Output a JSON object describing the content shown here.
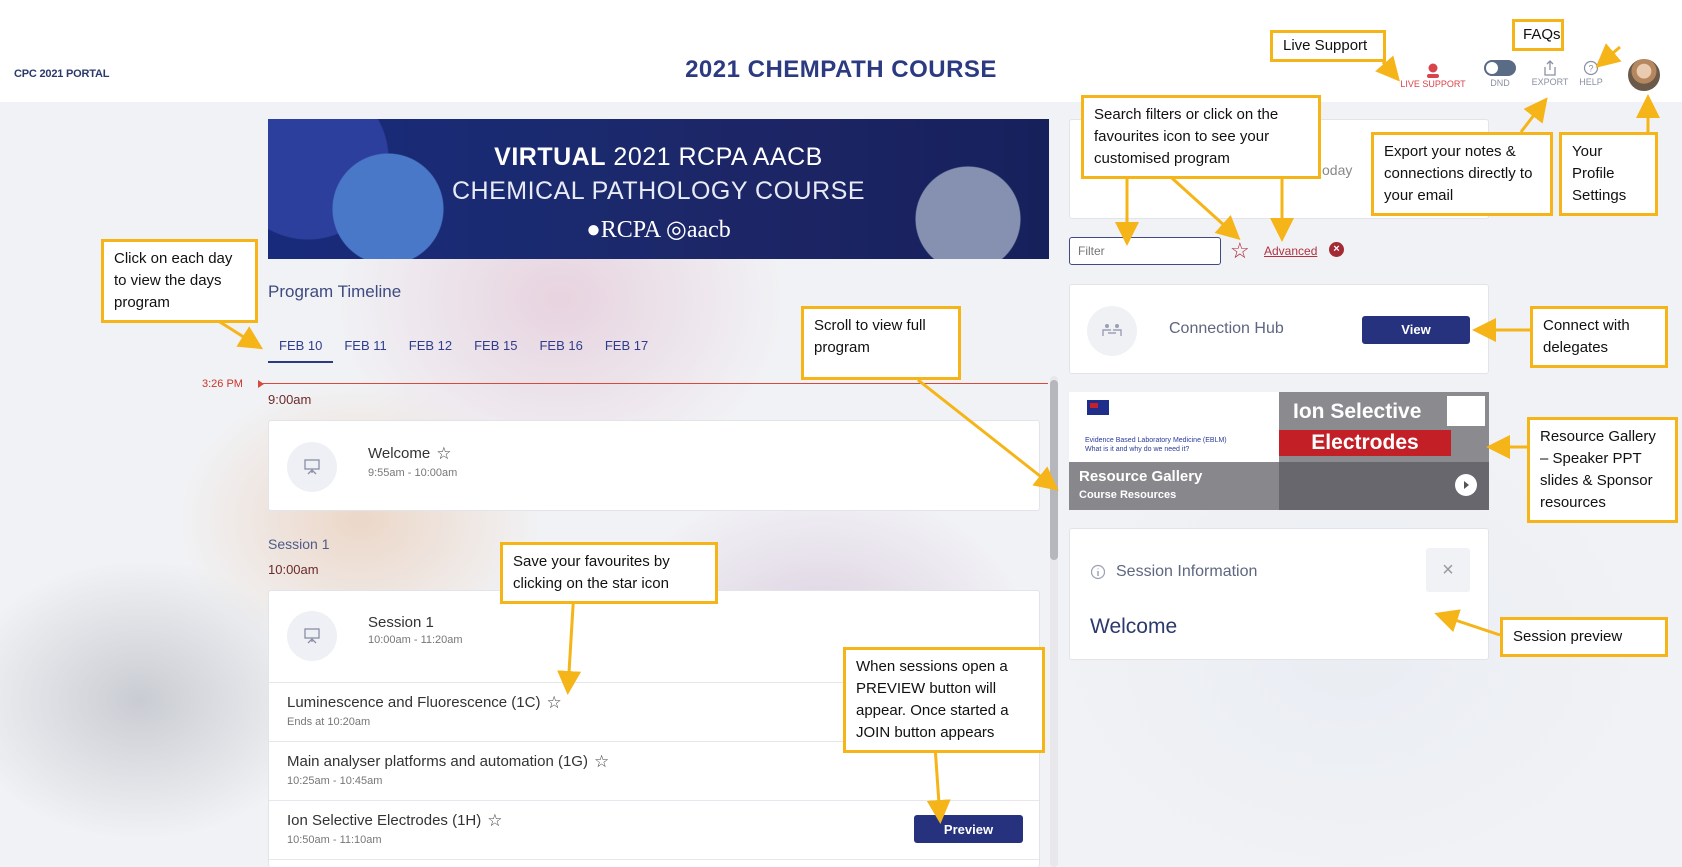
{
  "header": {
    "portal": "CPC 2021 PORTAL",
    "title": "2021 CHEMPATH COURSE",
    "live_support": "LIVE SUPPORT",
    "dnd": "DND",
    "export": "EXPORT",
    "help": "HELP"
  },
  "banner": {
    "line1_bold": "VIRTUAL",
    "line1_rest": " 2021 RCPA AACB",
    "line2": "CHEMICAL PATHOLOGY COURSE",
    "line3": "●RCPA  ◎aacb"
  },
  "timeline": {
    "title": "Program Timeline",
    "tabs": [
      "FEB 10",
      "FEB 11",
      "FEB 12",
      "FEB 15",
      "FEB 16",
      "FEB 17"
    ],
    "active_tab": "FEB 10",
    "current_time": "3:26 PM"
  },
  "schedule": {
    "slot1_time": "9:00am",
    "welcome": {
      "title": "Welcome",
      "time": "9:55am - 10:00am"
    },
    "session_label": "Session 1",
    "slot2_time": "10:00am",
    "session1": {
      "title": "Session 1",
      "time": "10:00am - 11:20am"
    },
    "items": [
      {
        "title": "Luminescence and Fluorescence (1C)",
        "sub": "Ends at 10:20am"
      },
      {
        "title": "Main analyser platforms and automation (1G)",
        "sub": "10:25am - 10:45am"
      },
      {
        "title": "Ion Selective Electrodes (1H)",
        "sub": "10:50am - 11:10am",
        "button": "Preview"
      }
    ]
  },
  "right_panel": {
    "today_fragment": "oday",
    "filter_placeholder": "Filter",
    "advanced": "Advanced",
    "hub_label": "Connection Hub",
    "view_button": "View",
    "gallery": {
      "ebl_line1": "Evidence Based Laboratory Medicine (EBLM)",
      "ebl_line2": "What is it and why do we need it?",
      "ion_line1": "Ion Selective",
      "ion_line2": "Electrodes",
      "title": "Resource Gallery",
      "subtitle": "Course Resources"
    },
    "session_info": {
      "title": "Session Information",
      "body": "Welcome"
    }
  },
  "annotations": {
    "faqs": "FAQs",
    "live_support": "Live Support",
    "search": "Search filters or click on the favourites icon to see your customised program",
    "export": "Export your notes & connections directly to your email",
    "profile": "Your Profile Settings",
    "days": "Click on each day to view the days program",
    "scroll": "Scroll to view full program",
    "connect": "Connect with delegates",
    "gallery": "Resource Gallery – Speaker PPT slides & Sponsor resources",
    "favourites": "Save your favourites by clicking on the star icon",
    "preview": "When sessions open a PREVIEW button will appear. Once started a JOIN button appears",
    "session_preview": "Session preview"
  },
  "colors": {
    "primary": "#26327d",
    "accent_red": "#d74a3c",
    "annotation_border": "#f5b417"
  }
}
